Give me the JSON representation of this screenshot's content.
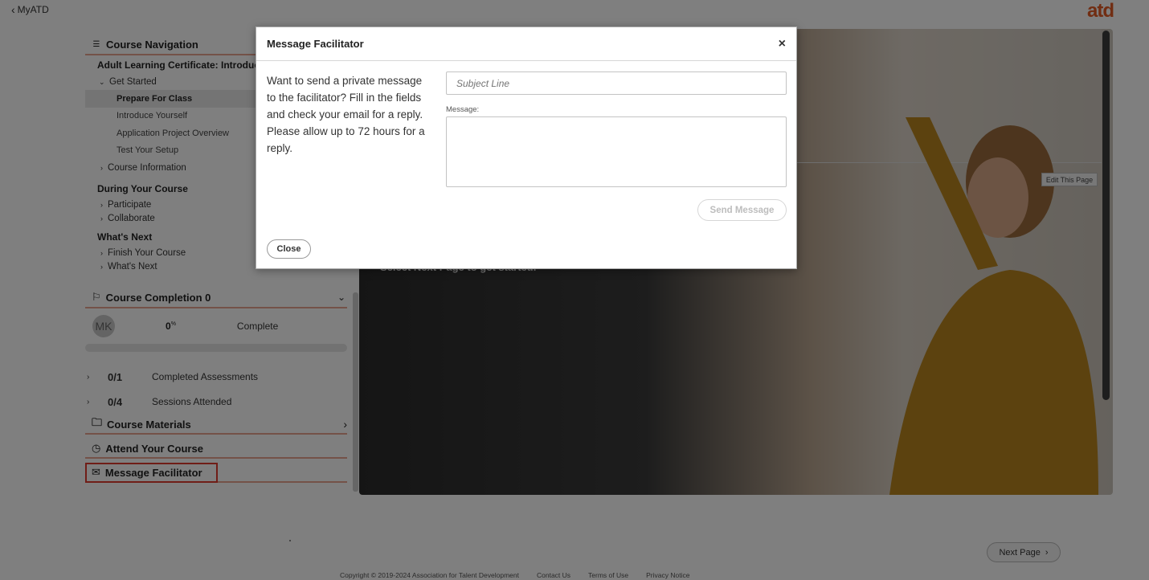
{
  "topbar": {
    "back_label": "MyATD",
    "logo": "atd"
  },
  "nav": {
    "section_title": "Course Navigation",
    "course_title": "Adult Learning Certificate: Introduct",
    "get_started": "Get Started",
    "get_started_items": [
      "Prepare For Class",
      "Introduce Yourself",
      "Application Project Overview",
      "Test Your Setup"
    ],
    "course_information": "Course Information",
    "during_title": "During Your Course",
    "during_items": [
      "Participate",
      "Collaborate"
    ],
    "whats_next_title": "What's Next",
    "whats_next_items": [
      "Finish Your Course",
      "What's Next"
    ]
  },
  "completion": {
    "title": "Course Completion 0",
    "avatar_initials": "MK",
    "percent": "0",
    "percent_unit": "%",
    "complete_label": "Complete",
    "progress_fraction": 0,
    "stats": [
      {
        "count": "0/1",
        "label": "Completed Assessments"
      },
      {
        "count": "0/4",
        "label": "Sessions Attended"
      }
    ]
  },
  "links": {
    "materials": "Course Materials",
    "attend": "Attend Your Course",
    "message": "Message Facilitator"
  },
  "hero": {
    "text": "Select Next Page to get started.",
    "edit_button": "Edit This Page",
    "next_button": "Next Page"
  },
  "footer": {
    "copyright": "Copyright © 2019-2024 Association for Talent Development",
    "contact": "Contact Us",
    "terms": "Terms of Use",
    "privacy": "Privacy Notice"
  },
  "modal": {
    "title": "Message Facilitator",
    "close_x": "×",
    "description": "Want to send a private message to the facilitator? Fill in the fields and check your email for a reply. Please allow up to 72 hours for a reply.",
    "subject_placeholder": "Subject Line",
    "message_label": "Message:",
    "message_value": "",
    "send_label": "Send Message",
    "close_label": "Close"
  }
}
